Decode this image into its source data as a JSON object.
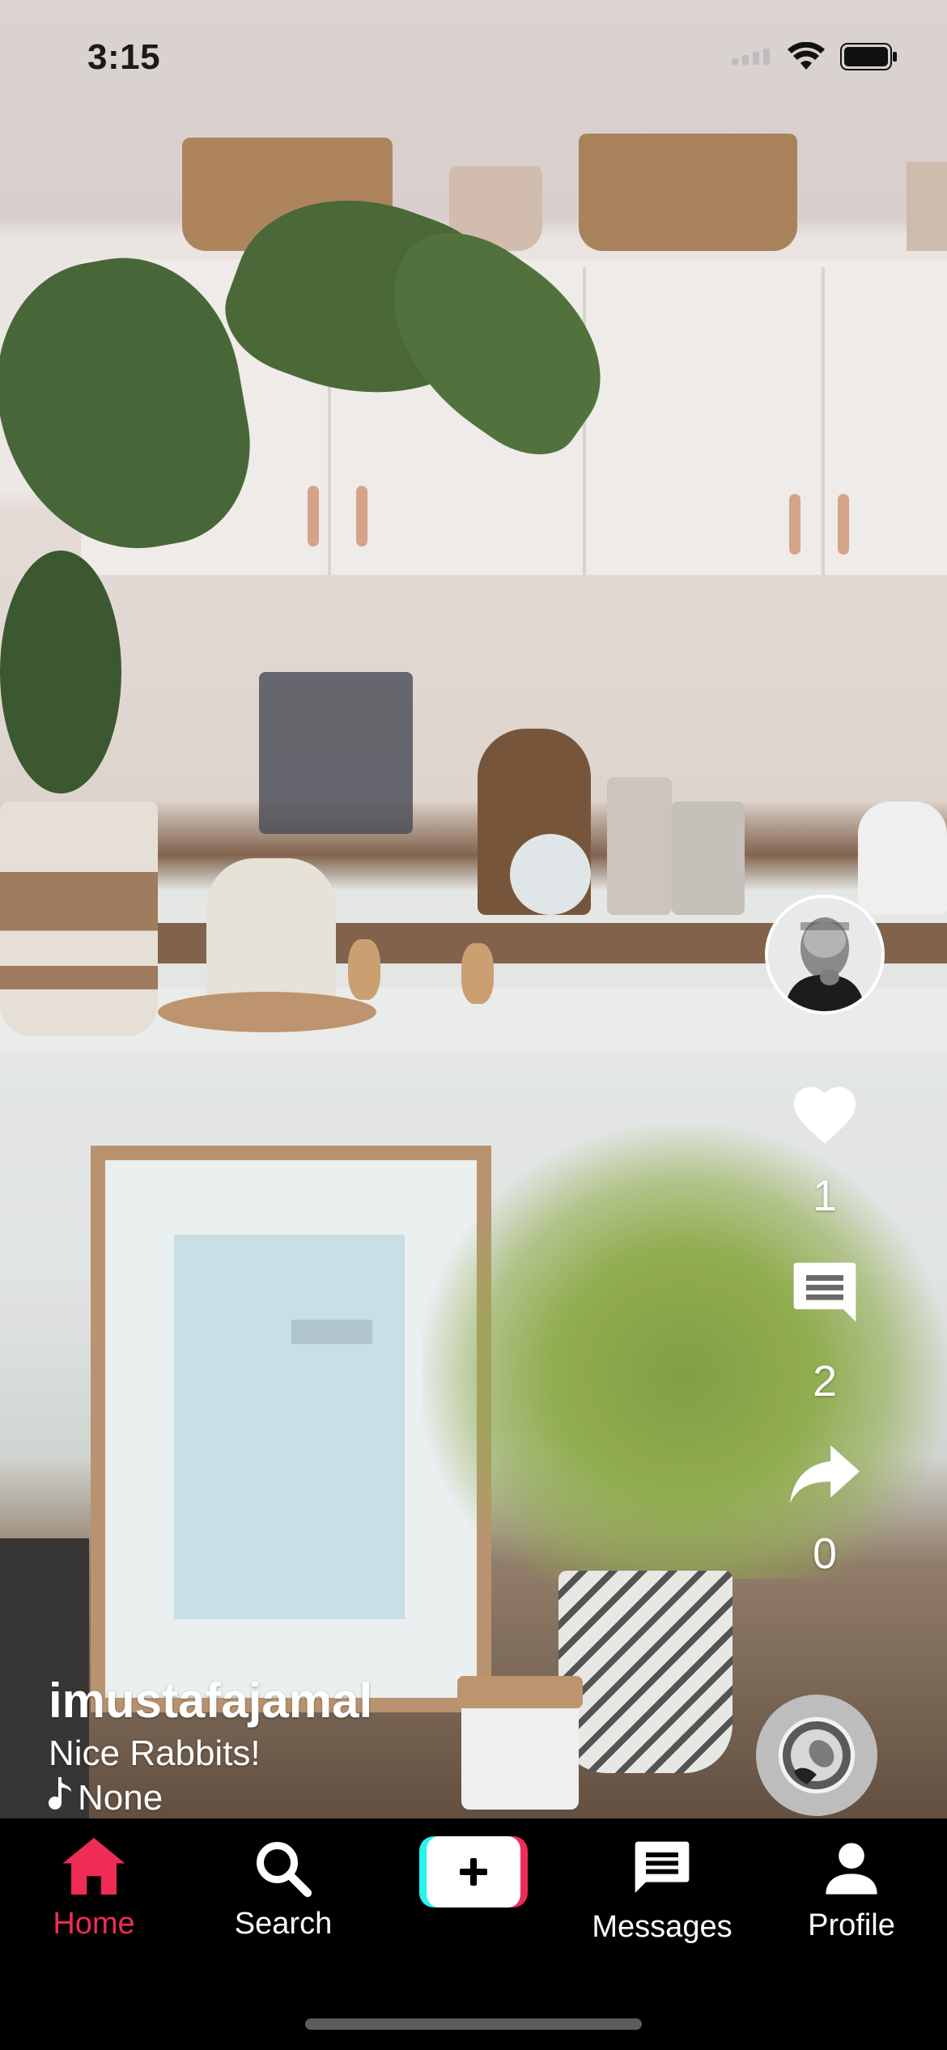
{
  "status_bar": {
    "time": "3:15"
  },
  "post": {
    "username": "imustafajamal",
    "description": "Nice Rabbits!",
    "music": "None",
    "likes": "1",
    "comments": "2",
    "shares": "0"
  },
  "tab_bar": {
    "items": [
      {
        "label": "Home",
        "icon": "home-icon",
        "active": true
      },
      {
        "label": "Search",
        "icon": "search-icon",
        "active": false
      },
      {
        "label": "",
        "icon": "add-icon",
        "active": false
      },
      {
        "label": "Messages",
        "icon": "message-icon",
        "active": false
      },
      {
        "label": "Profile",
        "icon": "person-icon",
        "active": false
      }
    ]
  },
  "colors": {
    "accent": "#ee2c55",
    "cyan": "#25f4ee",
    "tab_bar_bg": "#000000"
  }
}
